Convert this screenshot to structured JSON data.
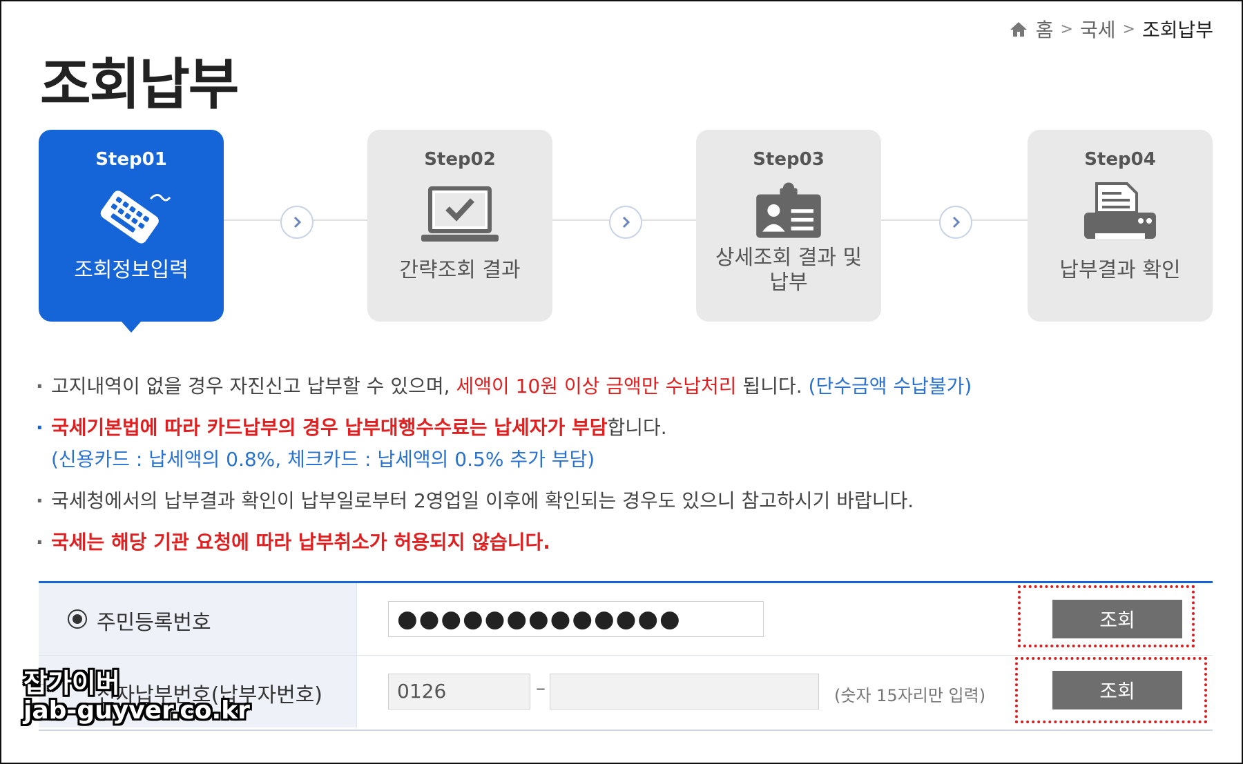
{
  "breadcrumb": {
    "home": "홈",
    "level1": "국세",
    "current": "조회납부",
    "separator": ">"
  },
  "page_title": "조회납부",
  "steps": [
    {
      "num": "Step01",
      "label": "조회정보입력",
      "icon": "keyboard-icon",
      "active": true
    },
    {
      "num": "Step02",
      "label": "간략조회 결과",
      "icon": "laptop-check-icon",
      "active": false
    },
    {
      "num": "Step03",
      "label": "상세조회 결과 및 납부",
      "icon": "id-card-icon",
      "active": false
    },
    {
      "num": "Step04",
      "label": "납부결과 확인",
      "icon": "printer-icon",
      "active": false
    }
  ],
  "notices": {
    "n1": {
      "a": "고지내역이 없을 경우 자진신고 납부할 수 있으며, ",
      "b": "세액이 10원 이상 금액만 수납처리",
      "c": " 됩니다. ",
      "d": "(단수금액 수납불가)"
    },
    "n2": {
      "a": "국세기본법에 따라 카드납부의 경우 납부대행수수료는 납세자가 부담",
      "b": "합니다.",
      "sub": "(신용카드 : 납세액의 0.8%, 체크카드 : 납세액의 0.5% 추가 부담)"
    },
    "n3": "국세청에서의 납부결과 확인이 납부일로부터 2영업일 이후에 확인되는 경우도 있으니 참고하시기 바랍니다.",
    "n4": "국세는 해당 기관 요청에 따라 납부취소가 허용되지 않습니다."
  },
  "form": {
    "row1": {
      "label": "주민등록번호",
      "value": "●●●●●●●●●●●●●",
      "button": "조회",
      "selected": true
    },
    "row2": {
      "label": "전자납부번호(납부자번호)",
      "prefix": "0126",
      "dash": "–",
      "value": "",
      "hint": "(숫자 15자리만 입력)",
      "button": "조회"
    }
  },
  "watermark": {
    "line1": "잡가이버",
    "line2": "jab-guyver.co.kr"
  },
  "colors": {
    "accent": "#1565d8",
    "warning": "#e02020",
    "info": "#2a72d0",
    "button": "#6e6e6e",
    "highlight": "#d61e1e"
  }
}
